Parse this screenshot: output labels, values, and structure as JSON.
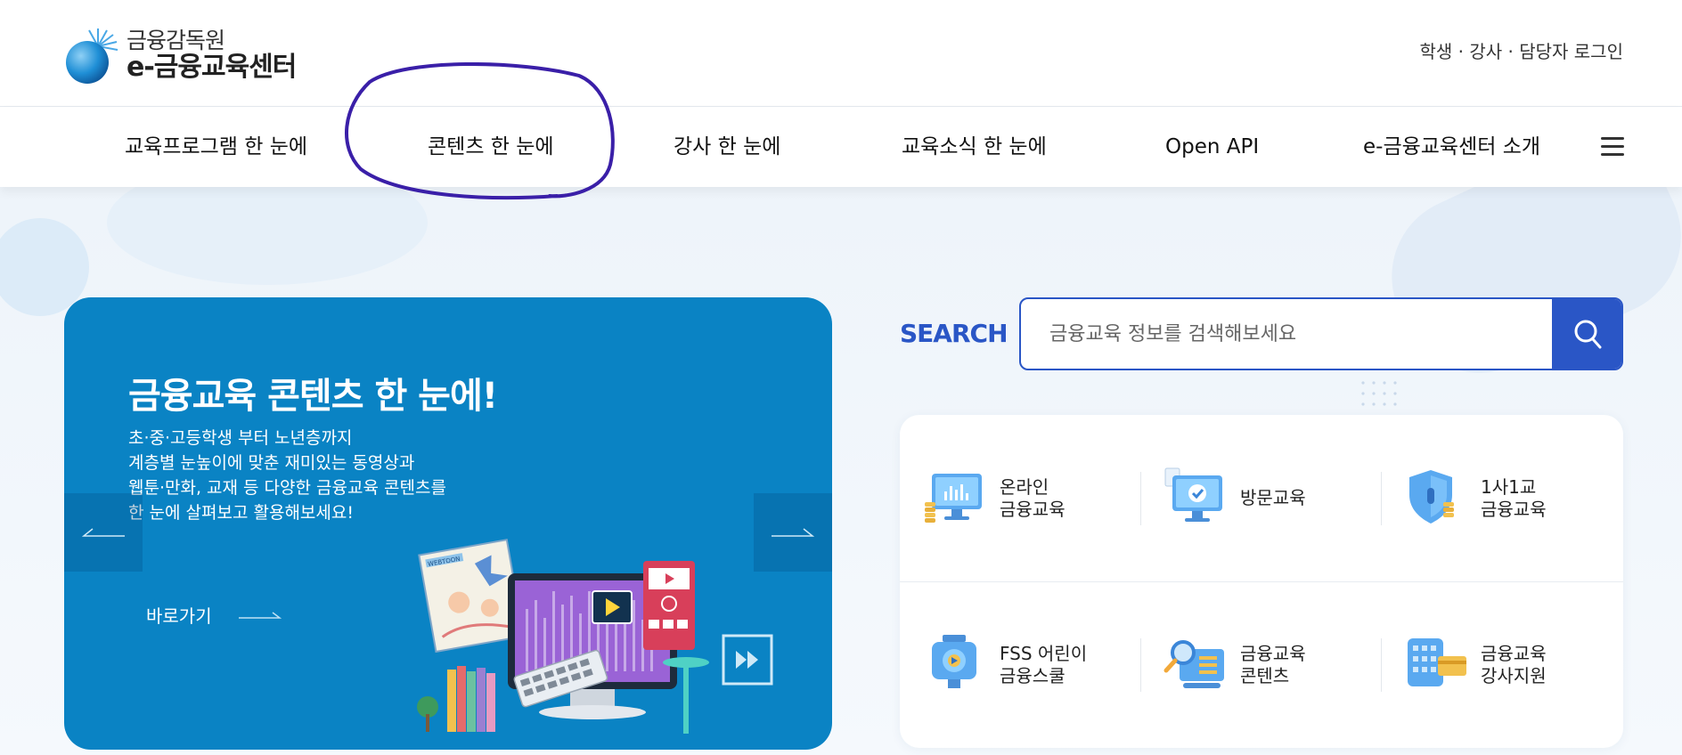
{
  "header": {
    "logo_top": "금융감독원",
    "logo_bottom": "e-금융교육센터",
    "util_links": "학생 · 강사 · 담당자 로그인"
  },
  "nav": {
    "items": [
      {
        "label": "교육프로그램 한 눈에"
      },
      {
        "label": "콘텐츠 한 눈에"
      },
      {
        "label": "강사 한 눈에"
      },
      {
        "label": "교육소식 한 눈에"
      },
      {
        "label": "Open API"
      },
      {
        "label": "e-금융교육센터 소개"
      }
    ],
    "menu_icon": "hamburger-icon",
    "annotation_color": "#3a1fa8"
  },
  "banner": {
    "title": "금융교육 콘텐츠 한 눈에!",
    "desc": [
      "초·중·고등학생 부터 노년층까지",
      "계층별 눈높이에 맞춘 재미있는 동영상과",
      "웹툰·만화, 교재 등 다양한 금융교육 콘텐츠를",
      "한 눈에 살펴보고 활용해보세요!"
    ],
    "link_label": "바로가기",
    "illustration_webtoon": "WEBTOON",
    "color": "#0a83c4"
  },
  "search": {
    "label": "SEARCH",
    "placeholder": "금융교육 정보를 검색해보세요",
    "button_icon": "search-icon",
    "color": "#2a56c6"
  },
  "quick_menu": [
    {
      "label": "온라인\n금융교육",
      "icon": "monitor-chart-icon"
    },
    {
      "label": "방문교육",
      "icon": "check-monitor-icon"
    },
    {
      "label": "1사1교\n금융교육",
      "icon": "shield-icon"
    },
    {
      "label": "FSS 어린이\n금융스쿨",
      "icon": "camera-icon"
    },
    {
      "label": "금융교육\n콘텐츠",
      "icon": "magnifier-board-icon"
    },
    {
      "label": "금융교육\n강사지원",
      "icon": "calculator-card-icon"
    }
  ]
}
